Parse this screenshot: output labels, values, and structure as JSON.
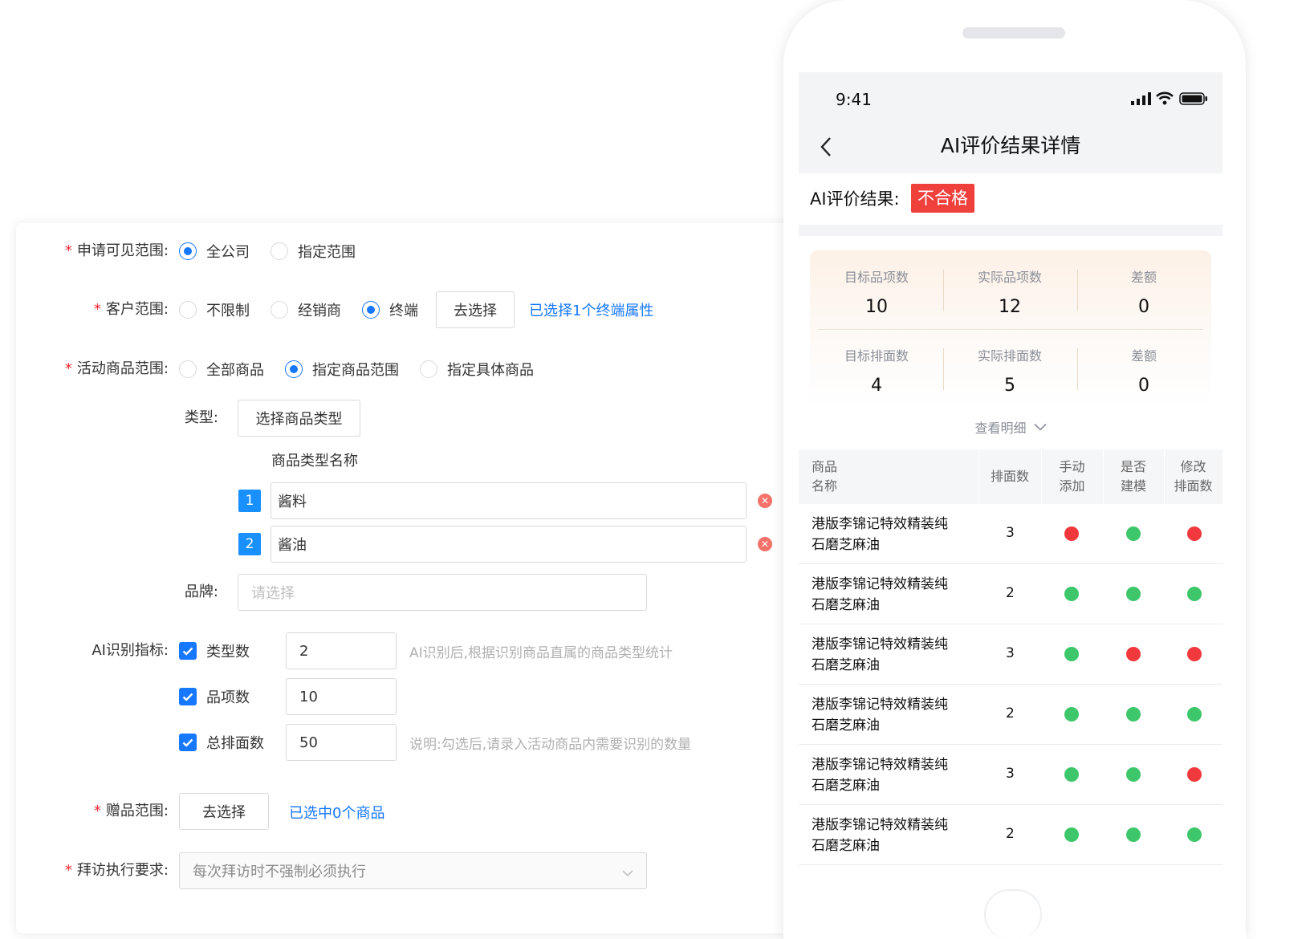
{
  "form": {
    "visible_scope": {
      "label": "申请可见范围:",
      "options": [
        {
          "label": "全公司",
          "selected": true
        },
        {
          "label": "指定范围",
          "selected": false
        }
      ]
    },
    "customer_scope": {
      "label": "客户范围:",
      "options": [
        {
          "label": "不限制",
          "selected": false
        },
        {
          "label": "经销商",
          "selected": false
        },
        {
          "label": "终端",
          "selected": true
        }
      ],
      "button": "去选择",
      "selected_text": "已选择1个终端属性"
    },
    "product_scope": {
      "label": "活动商品范围:",
      "options": [
        {
          "label": "全部商品",
          "selected": false
        },
        {
          "label": "指定商品范围",
          "selected": true
        },
        {
          "label": "指定具体商品",
          "selected": false
        }
      ]
    },
    "type": {
      "label": "类型:",
      "button": "选择商品类型",
      "column_header": "商品类型名称",
      "items": [
        {
          "index": "1",
          "value": "酱料"
        },
        {
          "index": "2",
          "value": "酱油"
        }
      ],
      "delete_icon": "close-icon"
    },
    "brand": {
      "label": "品牌:",
      "placeholder": "请选择"
    },
    "ai_metrics": {
      "label": "AI识别指标:",
      "items": [
        {
          "label": "类型数",
          "checked": true,
          "value": "2",
          "hint": "AI识别后,根据识别商品直属的商品类型统计"
        },
        {
          "label": "品项数",
          "checked": true,
          "value": "10",
          "hint": ""
        },
        {
          "label": "总排面数",
          "checked": true,
          "value": "50",
          "hint": "说明:勾选后,请录入活动商品内需要识别的数量"
        }
      ]
    },
    "gift_scope": {
      "label": "赠品范围:",
      "button": "去选择",
      "selected_text": "已选中0个商品"
    },
    "visit_requirement": {
      "label": "拜访执行要求:",
      "value": "每次拜访时不强制必须执行"
    }
  },
  "phone": {
    "status_time": "9:41",
    "title": "AI评价结果详情",
    "result_label": "AI评价结果:",
    "result_tag": "不合格",
    "result_tag_color": "#f0403c",
    "stats": [
      {
        "label": "目标品项数",
        "value": "10"
      },
      {
        "label": "实际品项数",
        "value": "12"
      },
      {
        "label": "差额",
        "value": "0"
      },
      {
        "label": "目标排面数",
        "value": "4"
      },
      {
        "label": "实际排面数",
        "value": "5"
      },
      {
        "label": "差额",
        "value": "0"
      }
    ],
    "more_label": "查看明细",
    "table": {
      "headers": [
        {
          "line1": "商品",
          "line2": "名称"
        },
        {
          "line1": "排面数",
          "line2": ""
        },
        {
          "line1": "手动",
          "line2": "添加"
        },
        {
          "line1": "是否",
          "line2": "建模"
        },
        {
          "line1": "修改",
          "line2": "排面数"
        }
      ],
      "rows": [
        {
          "line1": "港版李锦记特效精装纯",
          "line2": "石磨芝麻油",
          "count": "3",
          "manual": "red",
          "modeled": "green",
          "modified": "red"
        },
        {
          "line1": "港版李锦记特效精装纯",
          "line2": "石磨芝麻油",
          "count": "2",
          "manual": "green",
          "modeled": "green",
          "modified": "green"
        },
        {
          "line1": "港版李锦记特效精装纯",
          "line2": "石磨芝麻油",
          "count": "3",
          "manual": "green",
          "modeled": "red",
          "modified": "red"
        },
        {
          "line1": "港版李锦记特效精装纯",
          "line2": "石磨芝麻油",
          "count": "2",
          "manual": "green",
          "modeled": "green",
          "modified": "green"
        },
        {
          "line1": "港版李锦记特效精装纯",
          "line2": "石磨芝麻油",
          "count": "3",
          "manual": "green",
          "modeled": "green",
          "modified": "red"
        },
        {
          "line1": "港版李锦记特效精装纯",
          "line2": "石磨芝麻油",
          "count": "2",
          "manual": "green",
          "modeled": "green",
          "modified": "green"
        }
      ]
    },
    "colors": {
      "green": "#3ec76a",
      "red": "#f1383c"
    }
  }
}
